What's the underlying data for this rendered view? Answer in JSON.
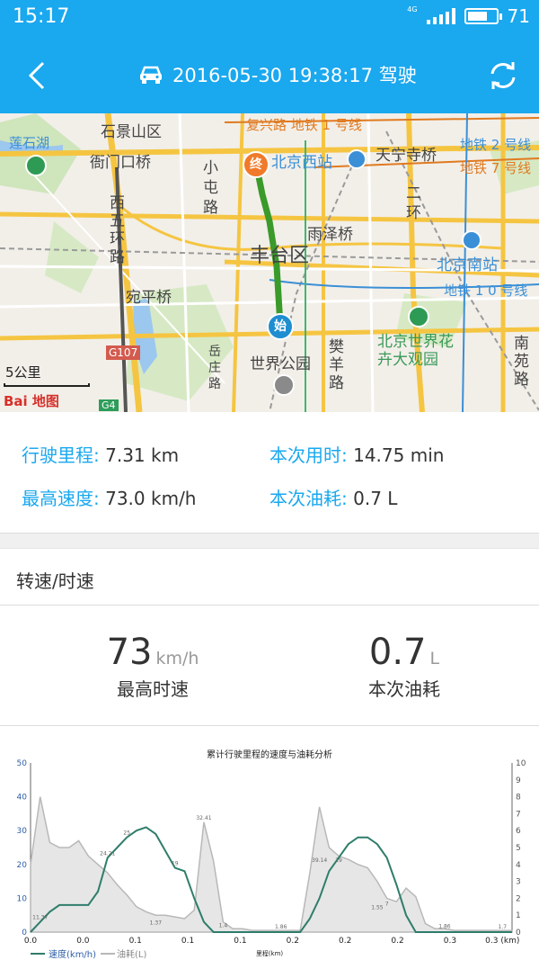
{
  "status_bar": {
    "time": "15:17",
    "network": "4G",
    "battery": "71",
    "battery_level": 0.71
  },
  "header": {
    "title": "2016-05-30 19:38:17  驾驶"
  },
  "map": {
    "labels": [
      {
        "text": "石景山区",
        "cls": ""
      },
      {
        "text": "复兴路 地铁 1 号线",
        "cls": "orange"
      },
      {
        "text": "莲石湖",
        "cls": "blue"
      },
      {
        "text": "衙门口桥",
        "cls": ""
      },
      {
        "text": "北京西站",
        "cls": "blue"
      },
      {
        "text": "天宁寺桥",
        "cls": ""
      },
      {
        "text": "地铁 2 号线",
        "cls": "blue"
      },
      {
        "text": "地铁 7 号线",
        "cls": "orange"
      },
      {
        "text": "小屯路",
        "cls": ""
      },
      {
        "text": "西五环路",
        "cls": ""
      },
      {
        "text": "丰台区",
        "cls": ""
      },
      {
        "text": "雨泽桥",
        "cls": ""
      },
      {
        "text": "二环",
        "cls": ""
      },
      {
        "text": "北京南站",
        "cls": "blue"
      },
      {
        "text": "宛平桥",
        "cls": ""
      },
      {
        "text": "地铁 1 0 号线",
        "cls": "blue"
      },
      {
        "text": "G107",
        "cls": ""
      },
      {
        "text": "世界公园",
        "cls": ""
      },
      {
        "text": "北京世界花卉大观园",
        "cls": ""
      },
      {
        "text": "南苑路",
        "cls": ""
      },
      {
        "text": "樊羊路",
        "cls": ""
      },
      {
        "text": "岳庄路",
        "cls": ""
      },
      {
        "text": "G4",
        "cls": ""
      }
    ],
    "end_marker": "终",
    "start_marker": "始",
    "scale": "5公里",
    "logo": "Bai 地图"
  },
  "stats": {
    "distance_label": "行驶里程:",
    "distance_value": "7.31 km",
    "duration_label": "本次用时:",
    "duration_value": "14.75 min",
    "max_speed_label": "最高速度:",
    "max_speed_value": "73.0 km/h",
    "fuel_label": "本次油耗:",
    "fuel_value": "0.7 L"
  },
  "section": {
    "title": "转速/时速"
  },
  "summary": {
    "speed_value": "73",
    "speed_unit": "km/h",
    "speed_caption": "最高时速",
    "fuel_value": "0.7",
    "fuel_unit": "L",
    "fuel_caption": "本次油耗"
  },
  "chart_data": {
    "type": "line",
    "title": "累计行驶里程的速度与油耗分析",
    "xlabel": "里程(km)",
    "x_ticks": [
      "0.0",
      "0.0",
      "0.1",
      "0.1",
      "0.1",
      "0.2",
      "0.2",
      "0.2",
      "0.3",
      "0.3 (km)"
    ],
    "y_left": {
      "ticks": [
        "0",
        "10",
        "20",
        "30",
        "40",
        "50"
      ],
      "range": [
        0,
        50
      ]
    },
    "y_right": {
      "ticks": [
        "0",
        "1",
        "2",
        "3",
        "4",
        "5",
        "6",
        "7",
        "8",
        "9",
        "10"
      ],
      "range": [
        0,
        10
      ]
    },
    "legend": [
      "速度(km/h)",
      "油耗(L)"
    ],
    "colors": {
      "speed": "#2e7d6b",
      "fuel": "#b8b8b8"
    },
    "speed_series": [
      [
        0,
        0
      ],
      [
        1,
        3
      ],
      [
        2,
        6
      ],
      [
        3,
        8
      ],
      [
        4,
        8
      ],
      [
        5,
        8
      ],
      [
        6,
        8
      ],
      [
        7,
        12
      ],
      [
        8,
        22
      ],
      [
        9,
        25
      ],
      [
        10,
        28
      ],
      [
        11,
        30
      ],
      [
        12,
        31
      ],
      [
        13,
        29
      ],
      [
        14,
        24
      ],
      [
        15,
        19
      ],
      [
        16,
        18
      ],
      [
        17,
        10
      ],
      [
        18,
        3
      ],
      [
        19,
        0
      ],
      [
        20,
        0
      ],
      [
        21,
        0
      ],
      [
        22,
        0
      ],
      [
        23,
        0
      ],
      [
        24,
        0
      ],
      [
        25,
        0
      ],
      [
        26,
        0
      ],
      [
        27,
        0
      ],
      [
        28,
        0
      ],
      [
        29,
        4
      ],
      [
        30,
        10
      ],
      [
        31,
        18
      ],
      [
        32,
        22
      ],
      [
        33,
        26
      ],
      [
        34,
        28
      ],
      [
        35,
        28
      ],
      [
        36,
        26
      ],
      [
        37,
        22
      ],
      [
        38,
        14
      ],
      [
        39,
        5
      ],
      [
        40,
        0
      ],
      [
        41,
        0
      ],
      [
        42,
        0
      ],
      [
        43,
        0
      ],
      [
        44,
        0
      ],
      [
        45,
        0
      ],
      [
        46,
        0
      ],
      [
        47,
        0
      ],
      [
        48,
        0
      ],
      [
        49,
        0
      ],
      [
        50,
        0
      ]
    ],
    "fuel_series": [
      [
        0,
        4
      ],
      [
        1,
        8
      ],
      [
        2,
        5.3
      ],
      [
        3,
        5
      ],
      [
        4,
        5
      ],
      [
        5,
        5.4
      ],
      [
        6,
        4.5
      ],
      [
        7,
        4
      ],
      [
        8,
        3.5
      ],
      [
        9,
        2.8
      ],
      [
        10,
        2.2
      ],
      [
        11,
        1.5
      ],
      [
        12,
        1.2
      ],
      [
        13,
        1.0
      ],
      [
        14,
        1.0
      ],
      [
        15,
        0.9
      ],
      [
        16,
        0.8
      ],
      [
        17,
        1.3
      ],
      [
        18,
        6.5
      ],
      [
        19,
        4.2
      ],
      [
        20,
        0.6
      ],
      [
        21,
        0.2
      ],
      [
        22,
        0.2
      ],
      [
        23,
        0.1
      ],
      [
        24,
        0.1
      ],
      [
        25,
        0.1
      ],
      [
        26,
        0.1
      ],
      [
        27,
        0.1
      ],
      [
        28,
        0.1
      ],
      [
        29,
        3.5
      ],
      [
        30,
        7.4
      ],
      [
        31,
        5
      ],
      [
        32,
        4.5
      ],
      [
        33,
        4.3
      ],
      [
        34,
        4
      ],
      [
        35,
        3.8
      ],
      [
        36,
        3
      ],
      [
        37,
        2
      ],
      [
        38,
        1.8
      ],
      [
        39,
        2.6
      ],
      [
        40,
        2.1
      ],
      [
        41,
        0.5
      ],
      [
        42,
        0.2
      ],
      [
        43,
        0.2
      ],
      [
        44,
        0.1
      ],
      [
        45,
        0.1
      ],
      [
        46,
        0.1
      ],
      [
        47,
        0.1
      ],
      [
        48,
        0.1
      ],
      [
        49,
        0.1
      ],
      [
        50,
        0.1
      ]
    ],
    "point_labels": [
      {
        "x": 1,
        "y": 3,
        "text": "11.37"
      },
      {
        "x": 8,
        "y": 22,
        "text": "24.21"
      },
      {
        "x": 10,
        "y": 28,
        "text": "25"
      },
      {
        "x": 15,
        "y": 19,
        "text": "19"
      },
      {
        "x": 18,
        "y": 32.4,
        "text": "32.41"
      },
      {
        "x": 13,
        "y": 1.5,
        "text": "1.37"
      },
      {
        "x": 20,
        "y": 0.6,
        "text": "1.4"
      },
      {
        "x": 26,
        "y": 0.3,
        "text": "1.86"
      },
      {
        "x": 30,
        "y": 20,
        "text": "39.14"
      },
      {
        "x": 32,
        "y": 20,
        "text": "19"
      },
      {
        "x": 37,
        "y": 7,
        "text": "7"
      },
      {
        "x": 36,
        "y": 6,
        "text": "1.55"
      },
      {
        "x": 43,
        "y": 0.4,
        "text": "1.86"
      },
      {
        "x": 49,
        "y": 0.3,
        "text": "1.7"
      }
    ]
  }
}
